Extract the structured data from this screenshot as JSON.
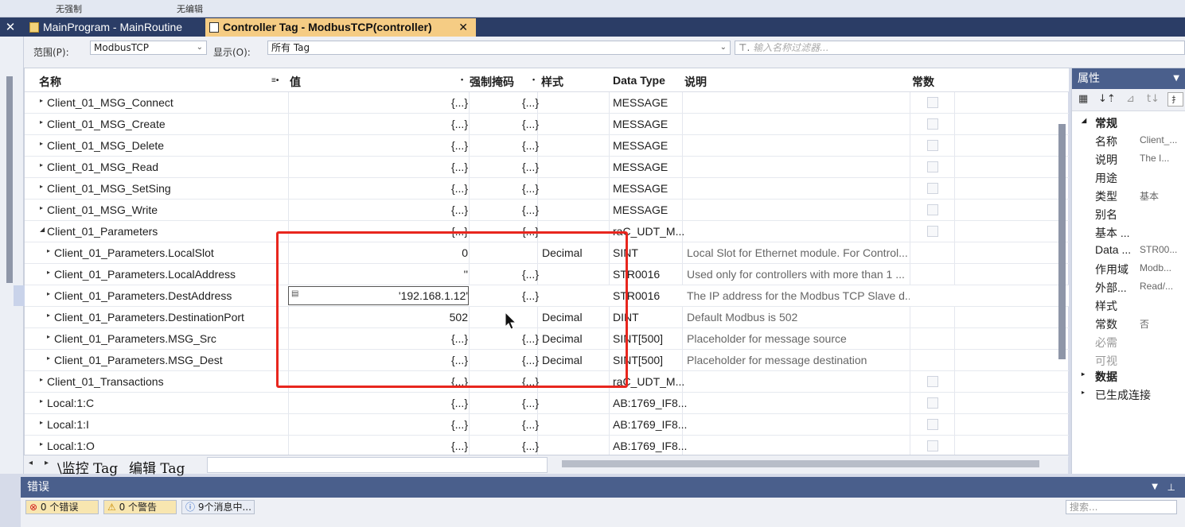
{
  "top_strip": {
    "item1": "无强制",
    "item2": "无编辑"
  },
  "tabs": {
    "main": "MainProgram - MainRoutine",
    "controller": "Controller Tag - ModbusTCP(controller)",
    "close": "✕",
    "left_close": "✕"
  },
  "filter": {
    "scope_label": "范围(P):",
    "scope_value": "ModbusTCP",
    "show_label": "显示(O):",
    "show_value": "所有 Tag",
    "search_placeholder": "输入名称过滤器..."
  },
  "columns": {
    "name": "名称",
    "value": "值",
    "force_mask": "强制掩码",
    "style": "样式",
    "data_type": "Data Type",
    "description": "说明",
    "constant": "常数"
  },
  "rows": [
    {
      "name": "Client_01_MSG_Connect",
      "value": "{...}",
      "mask": "{...}",
      "style": "",
      "type": "MESSAGE",
      "desc": "",
      "check": true
    },
    {
      "name": "Client_01_MSG_Create",
      "value": "{...}",
      "mask": "{...}",
      "style": "",
      "type": "MESSAGE",
      "desc": "",
      "check": true
    },
    {
      "name": "Client_01_MSG_Delete",
      "value": "{...}",
      "mask": "{...}",
      "style": "",
      "type": "MESSAGE",
      "desc": "",
      "check": true
    },
    {
      "name": "Client_01_MSG_Read",
      "value": "{...}",
      "mask": "{...}",
      "style": "",
      "type": "MESSAGE",
      "desc": "",
      "check": true
    },
    {
      "name": "Client_01_MSG_SetSing",
      "value": "{...}",
      "mask": "{...}",
      "style": "",
      "type": "MESSAGE",
      "desc": "",
      "check": true
    },
    {
      "name": "Client_01_MSG_Write",
      "value": "{...}",
      "mask": "{...}",
      "style": "",
      "type": "MESSAGE",
      "desc": "",
      "check": true
    },
    {
      "name": "Client_01_Parameters",
      "value": "{...}",
      "mask": "{...}",
      "style": "",
      "type": "raC_UDT_M...",
      "desc": "",
      "check": true
    },
    {
      "name": "Client_01_Parameters.LocalSlot",
      "value": "0",
      "mask": "",
      "style": "Decimal",
      "type": "SINT",
      "desc": "Local Slot for Ethernet module. For Control...",
      "check": false
    },
    {
      "name": "Client_01_Parameters.LocalAddress",
      "value": "''",
      "mask": "{...}",
      "style": "",
      "type": "STR0016",
      "desc": "Used only for controllers with more than 1 ...",
      "check": false
    },
    {
      "name": "Client_01_Parameters.DestAddress",
      "value": "'192.168.1.12'",
      "mask": "{...}",
      "style": "",
      "type": "STR0016",
      "desc": "The IP address for the Modbus TCP Slave d...",
      "check": false
    },
    {
      "name": "Client_01_Parameters.DestinationPort",
      "value": "502",
      "mask": "",
      "style": "Decimal",
      "type": "DINT",
      "desc": "Default Modbus is 502",
      "check": false
    },
    {
      "name": "Client_01_Parameters.MSG_Src",
      "value": "{...}",
      "mask": "{...}",
      "style": "Decimal",
      "type": "SINT[500]",
      "desc": "Placeholder for message source",
      "check": false
    },
    {
      "name": "Client_01_Parameters.MSG_Dest",
      "value": "{...}",
      "mask": "{...}",
      "style": "Decimal",
      "type": "SINT[500]",
      "desc": "Placeholder for message destination",
      "check": false
    },
    {
      "name": "Client_01_Transactions",
      "value": "{...}",
      "mask": "{...}",
      "style": "",
      "type": "raC_UDT_M...",
      "desc": "",
      "check": true
    },
    {
      "name": "Local:1:C",
      "value": "{...}",
      "mask": "{...}",
      "style": "",
      "type": "AB:1769_IF8...",
      "desc": "",
      "check": true
    },
    {
      "name": "Local:1:I",
      "value": "{...}",
      "mask": "{...}",
      "style": "",
      "type": "AB:1769_IF8...",
      "desc": "",
      "check": true
    },
    {
      "name": "Local:1:O",
      "value": "{...}",
      "mask": "{...}",
      "style": "",
      "type": "AB:1769_IF8...",
      "desc": "",
      "check": true
    }
  ],
  "bottom_tabs": {
    "monitor": "\\监控 Tag",
    "edit": "编辑 Tag"
  },
  "properties": {
    "title": "属性",
    "category_general": "常规",
    "items": [
      {
        "k": "名称",
        "v": "Client_..."
      },
      {
        "k": "说明",
        "v": "The I..."
      },
      {
        "k": "用途",
        "v": ""
      },
      {
        "k": "类型",
        "v": "基本"
      },
      {
        "k": "别名",
        "v": ""
      },
      {
        "k": "基本 ...",
        "v": ""
      },
      {
        "k": "Data ...",
        "v": "STR00..."
      },
      {
        "k": "作用域",
        "v": "Modb..."
      },
      {
        "k": "外部...",
        "v": "Read/..."
      },
      {
        "k": "样式",
        "v": ""
      },
      {
        "k": "常数",
        "v": "否"
      },
      {
        "k": "必需",
        "v": ""
      },
      {
        "k": "可视",
        "v": ""
      }
    ],
    "category_data": "数据",
    "category_conn": "已生成连接"
  },
  "errors": {
    "title": "错误",
    "errors_btn": "0 个错误",
    "warnings_btn": "0 个警告",
    "messages_btn": "9个消息中...",
    "search_placeholder": "搜索..."
  },
  "colors": {
    "tab_active": "#f5cc84",
    "title_bar": "#2b3d66",
    "panel_title": "#4a5f8c",
    "highlight_box": "#e8261e"
  }
}
